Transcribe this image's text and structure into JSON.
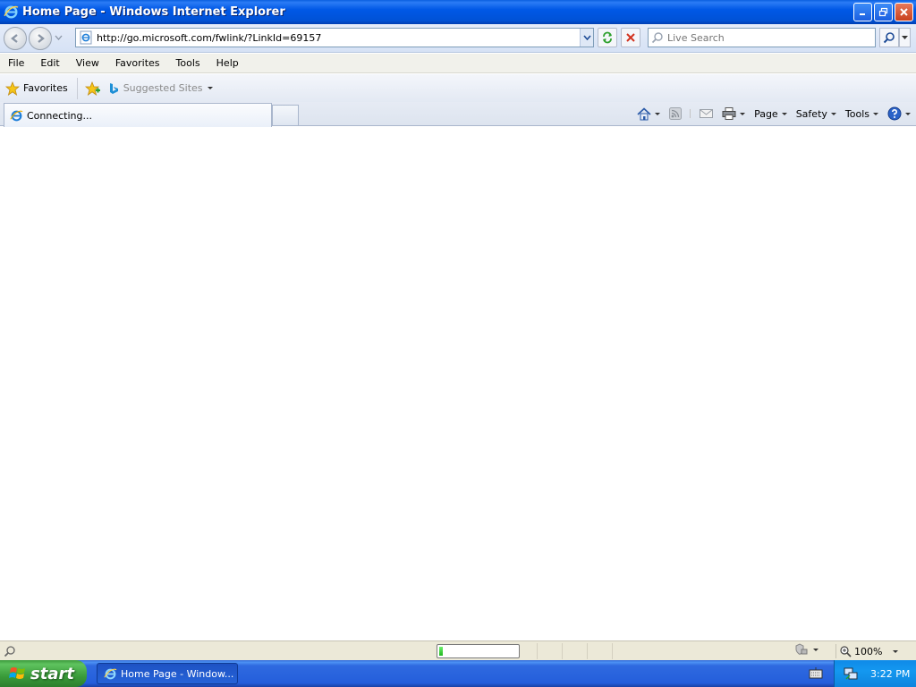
{
  "window": {
    "title": "Home Page - Windows Internet Explorer"
  },
  "address_bar": {
    "url": "http://go.microsoft.com/fwlink/?LinkId=69157"
  },
  "search": {
    "placeholder": "Live Search"
  },
  "menu": {
    "items": [
      "File",
      "Edit",
      "View",
      "Favorites",
      "Tools",
      "Help"
    ]
  },
  "favorites_bar": {
    "favorites_label": "Favorites",
    "suggested_label": "Suggested Sites"
  },
  "tabs": {
    "active_label": "Connecting..."
  },
  "command_bar": {
    "page_label": "Page",
    "safety_label": "Safety",
    "tools_label": "Tools"
  },
  "status_bar": {
    "progress_percent": 5,
    "zoom": "100%"
  },
  "taskbar": {
    "start_label": "start",
    "task_item": "Home Page - Window...",
    "clock": "3:22 PM"
  },
  "colors": {
    "title_bar": "#0054e3",
    "taskbar": "#245edb",
    "start_button": "#3a9c3a",
    "progress_fill": "#1fb61f"
  }
}
